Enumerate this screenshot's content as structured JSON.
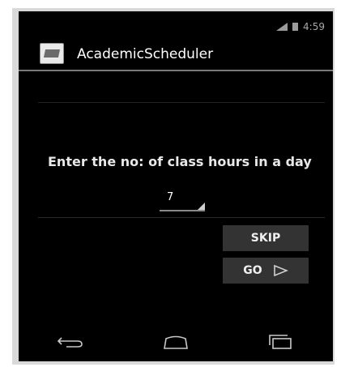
{
  "status_bar": {
    "time": "4:59",
    "icons": [
      "signal-icon",
      "battery-icon"
    ]
  },
  "action_bar": {
    "title": "AcademicScheduler",
    "icon": "app-icon"
  },
  "content": {
    "prompt": "Enter the no: of class hours in a day",
    "spinner_value": "7"
  },
  "buttons": {
    "skip_label": "SKIP",
    "go_label": "GO",
    "go_icon": "play-icon"
  },
  "nav_bar": {
    "icons": [
      "back-icon",
      "home-icon",
      "recents-icon"
    ]
  },
  "colors": {
    "background": "#000000",
    "button_bg": "#333333",
    "text": "#ffffff",
    "secondary_text": "#a8a8a8"
  }
}
